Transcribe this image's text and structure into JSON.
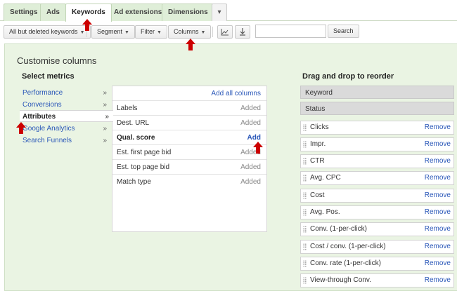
{
  "tabs": [
    {
      "label": "Settings"
    },
    {
      "label": "Ads"
    },
    {
      "label": "Keywords"
    },
    {
      "label": "Ad extensions"
    },
    {
      "label": "Dimensions"
    },
    {
      "label": "▾"
    }
  ],
  "toolbar": {
    "filter_all": "All but deleted keywords",
    "segment": "Segment",
    "filter": "Filter",
    "columns": "Columns",
    "search_button": "Search",
    "search_value": ""
  },
  "panel": {
    "title": "Customise columns",
    "select_metrics": "Select metrics",
    "drag_title": "Drag and drop to reorder",
    "add_all": "Add all columns"
  },
  "categories": [
    {
      "label": "Performance",
      "chev": "»"
    },
    {
      "label": "Conversions",
      "chev": "»"
    },
    {
      "label": "Attributes",
      "chev": "»"
    },
    {
      "label": "Google Analytics",
      "chev": "»"
    },
    {
      "label": "Search Funnels",
      "chev": "»"
    }
  ],
  "metrics": [
    {
      "name": "Labels",
      "status": "Added"
    },
    {
      "name": "Dest. URL",
      "status": "Added"
    },
    {
      "name": "Qual. score",
      "status": "Add"
    },
    {
      "name": "Est. first page bid",
      "status": "Added"
    },
    {
      "name": "Est. top page bid",
      "status": "Added"
    },
    {
      "name": "Match type",
      "status": "Added"
    }
  ],
  "fixed_columns": [
    "Keyword",
    "Status"
  ],
  "columns": [
    {
      "name": "Clicks",
      "action": "Remove"
    },
    {
      "name": "Impr.",
      "action": "Remove"
    },
    {
      "name": "CTR",
      "action": "Remove"
    },
    {
      "name": "Avg. CPC",
      "action": "Remove"
    },
    {
      "name": "Cost",
      "action": "Remove"
    },
    {
      "name": "Avg. Pos.",
      "action": "Remove"
    },
    {
      "name": "Conv. (1-per-click)",
      "action": "Remove"
    },
    {
      "name": "Cost / conv. (1-per-click)",
      "action": "Remove"
    },
    {
      "name": "Conv. rate (1-per-click)",
      "action": "Remove"
    },
    {
      "name": "View-through Conv.",
      "action": "Remove"
    }
  ],
  "colors": {
    "accent": "#cc0000",
    "link": "#2a57b8",
    "panel_bg": "#eaf4e3",
    "tab_bg": "#dfeed8"
  }
}
